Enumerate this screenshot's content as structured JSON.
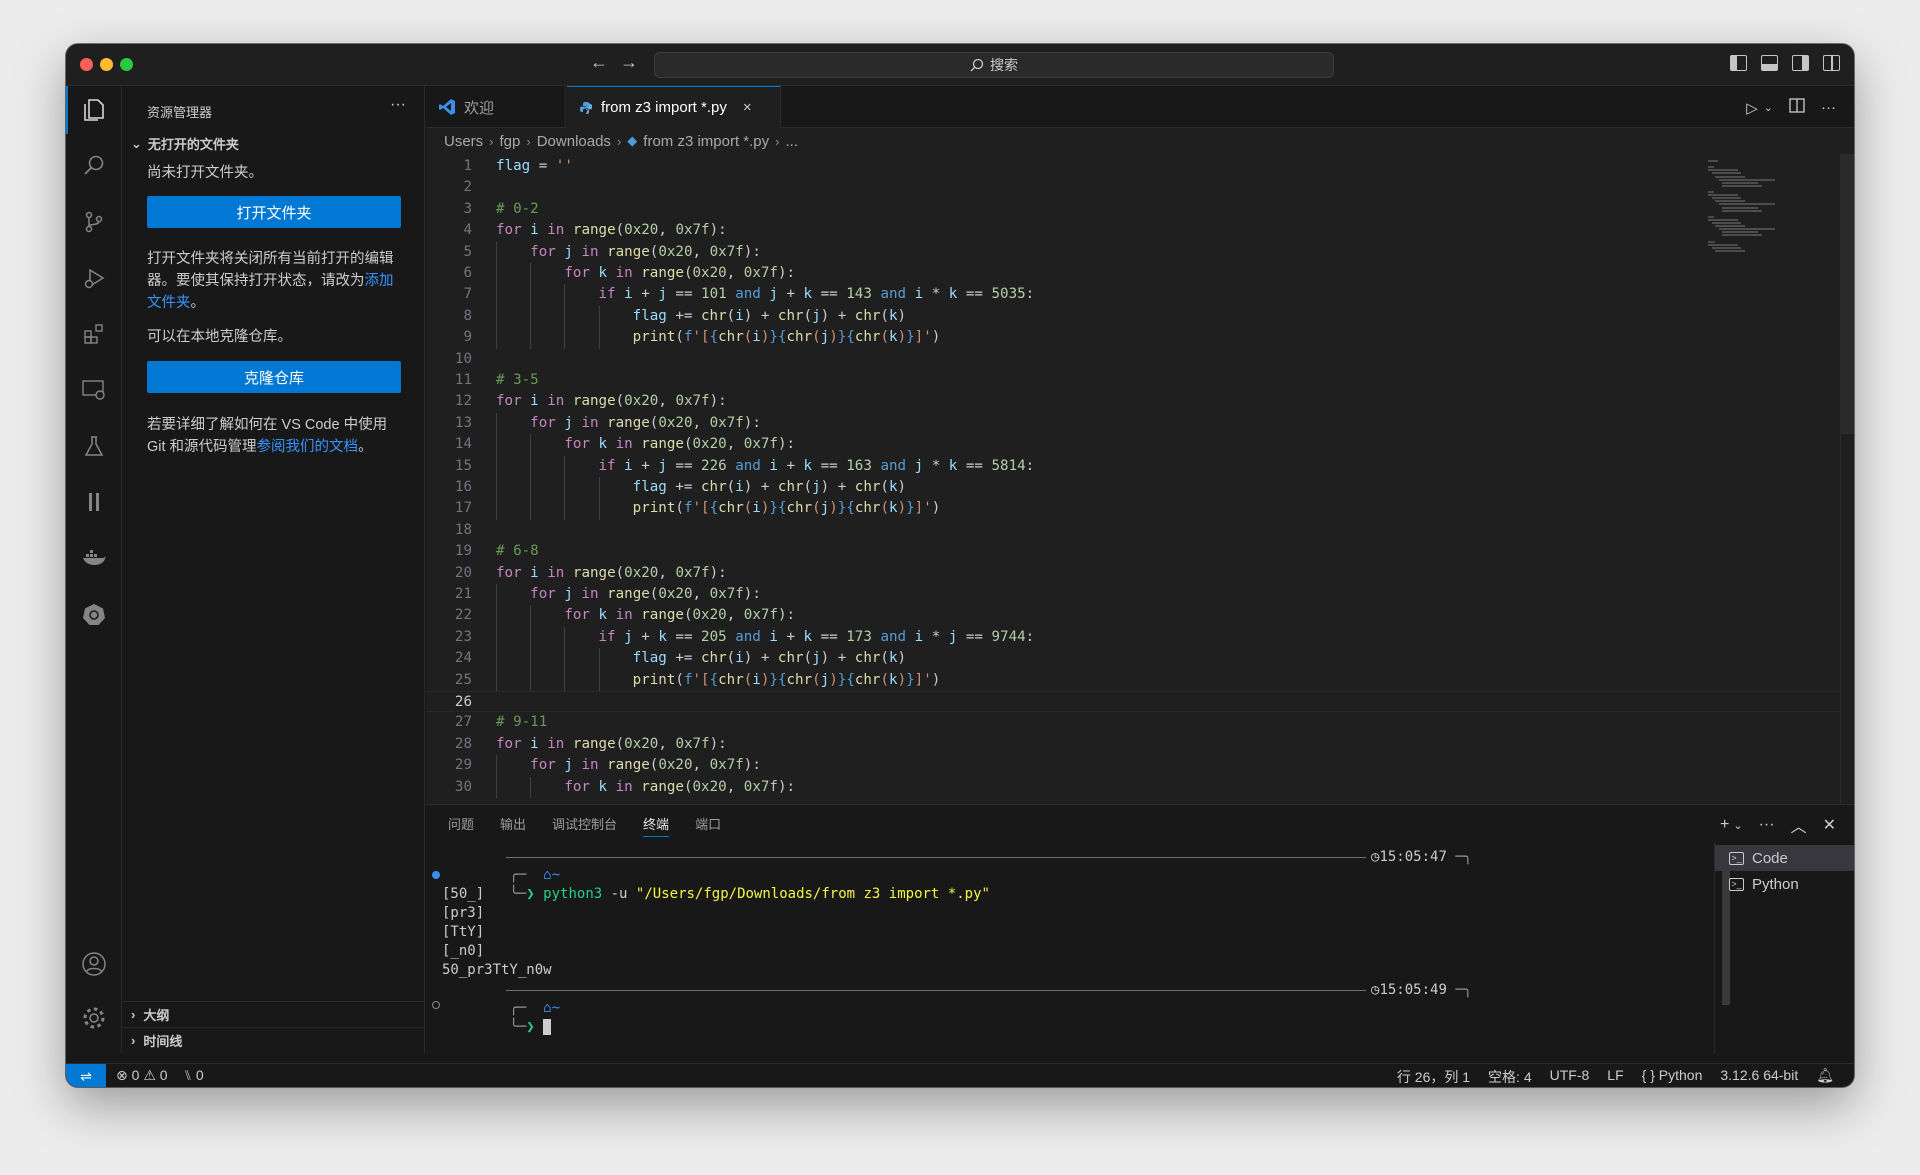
{
  "titlebar": {
    "search_placeholder": "搜索",
    "back_icon": "arrow-left-icon",
    "forward_icon": "arrow-right-icon"
  },
  "sidebar": {
    "title": "资源管理器",
    "more": "···",
    "section": "无打开的文件夹",
    "no_folder_text": "尚未打开文件夹。",
    "open_folder_button": "打开文件夹",
    "info_text": "打开文件夹将关闭所有当前打开的编辑器。要使其保持打开状态，请改为",
    "add_folder_link": "添加文件夹",
    "period": "。",
    "clone_text": "可以在本地克隆仓库。",
    "clone_button": "克隆仓库",
    "learn_text": "若要详细了解如何在 VS Code 中使用 Git 和源代码管理",
    "docs_link": "参阅我们的文档",
    "outline": "大纲",
    "timeline": "时间线"
  },
  "tabs": {
    "welcome": "欢迎",
    "file": "from z3 import *.py",
    "close": "×"
  },
  "breadcrumb": [
    "Users",
    "fgp",
    "Downloads",
    "from z3 import *.py",
    "..."
  ],
  "editor": {
    "current_line": 26,
    "lines": [
      "flag = ''",
      "",
      "# 0-2",
      "for i in range(0x20, 0x7f):",
      "    for j in range(0x20, 0x7f):",
      "        for k in range(0x20, 0x7f):",
      "            if i + j == 101 and j + k == 143 and i * k == 5035:",
      "                flag += chr(i) + chr(j) + chr(k)",
      "                print(f'[{chr(i)}{chr(j)}{chr(k)}]')",
      "",
      "# 3-5",
      "for i in range(0x20, 0x7f):",
      "    for j in range(0x20, 0x7f):",
      "        for k in range(0x20, 0x7f):",
      "            if i + j == 226 and i + k == 163 and j * k == 5814:",
      "                flag += chr(i) + chr(j) + chr(k)",
      "                print(f'[{chr(i)}{chr(j)}{chr(k)}]')",
      "",
      "# 6-8",
      "for i in range(0x20, 0x7f):",
      "    for j in range(0x20, 0x7f):",
      "        for k in range(0x20, 0x7f):",
      "            if j + k == 205 and i + k == 173 and i * j == 9744:",
      "                flag += chr(i) + chr(j) + chr(k)",
      "                print(f'[{chr(i)}{chr(j)}{chr(k)}]')",
      "",
      "# 9-11",
      "for i in range(0x20, 0x7f):",
      "    for j in range(0x20, 0x7f):",
      "        for k in range(0x20, 0x7f):"
    ]
  },
  "panel": {
    "tabs": [
      "问题",
      "输出",
      "调试控制台",
      "终端",
      "端口"
    ],
    "active_tab": "终端",
    "terminal": {
      "prompt_suffix": "~",
      "time1": "15:05:47",
      "command": "python3",
      "args": "-u",
      "path": "\"/Users/fgp/Downloads/from z3 import *.py\"",
      "output": [
        "[50_]",
        "[pr3]",
        "[TtY]",
        "[_n0]",
        "50_pr3TtY_n0w"
      ],
      "time2": "15:05:49"
    },
    "terminal_list": [
      "Code",
      "Python"
    ]
  },
  "statusbar": {
    "errors": "0",
    "warnings": "0",
    "ports": "0",
    "position": "行 26，列 1",
    "spaces": "空格: 4",
    "encoding": "UTF-8",
    "eol": "LF",
    "language": "Python",
    "interpreter": "3.12.6 64-bit"
  },
  "colors": {
    "accent": "#0078d4",
    "keyword": "#c586c0",
    "function": "#dcdcaa",
    "number": "#b5cea8",
    "string": "#ce9178",
    "comment": "#6a9955"
  }
}
